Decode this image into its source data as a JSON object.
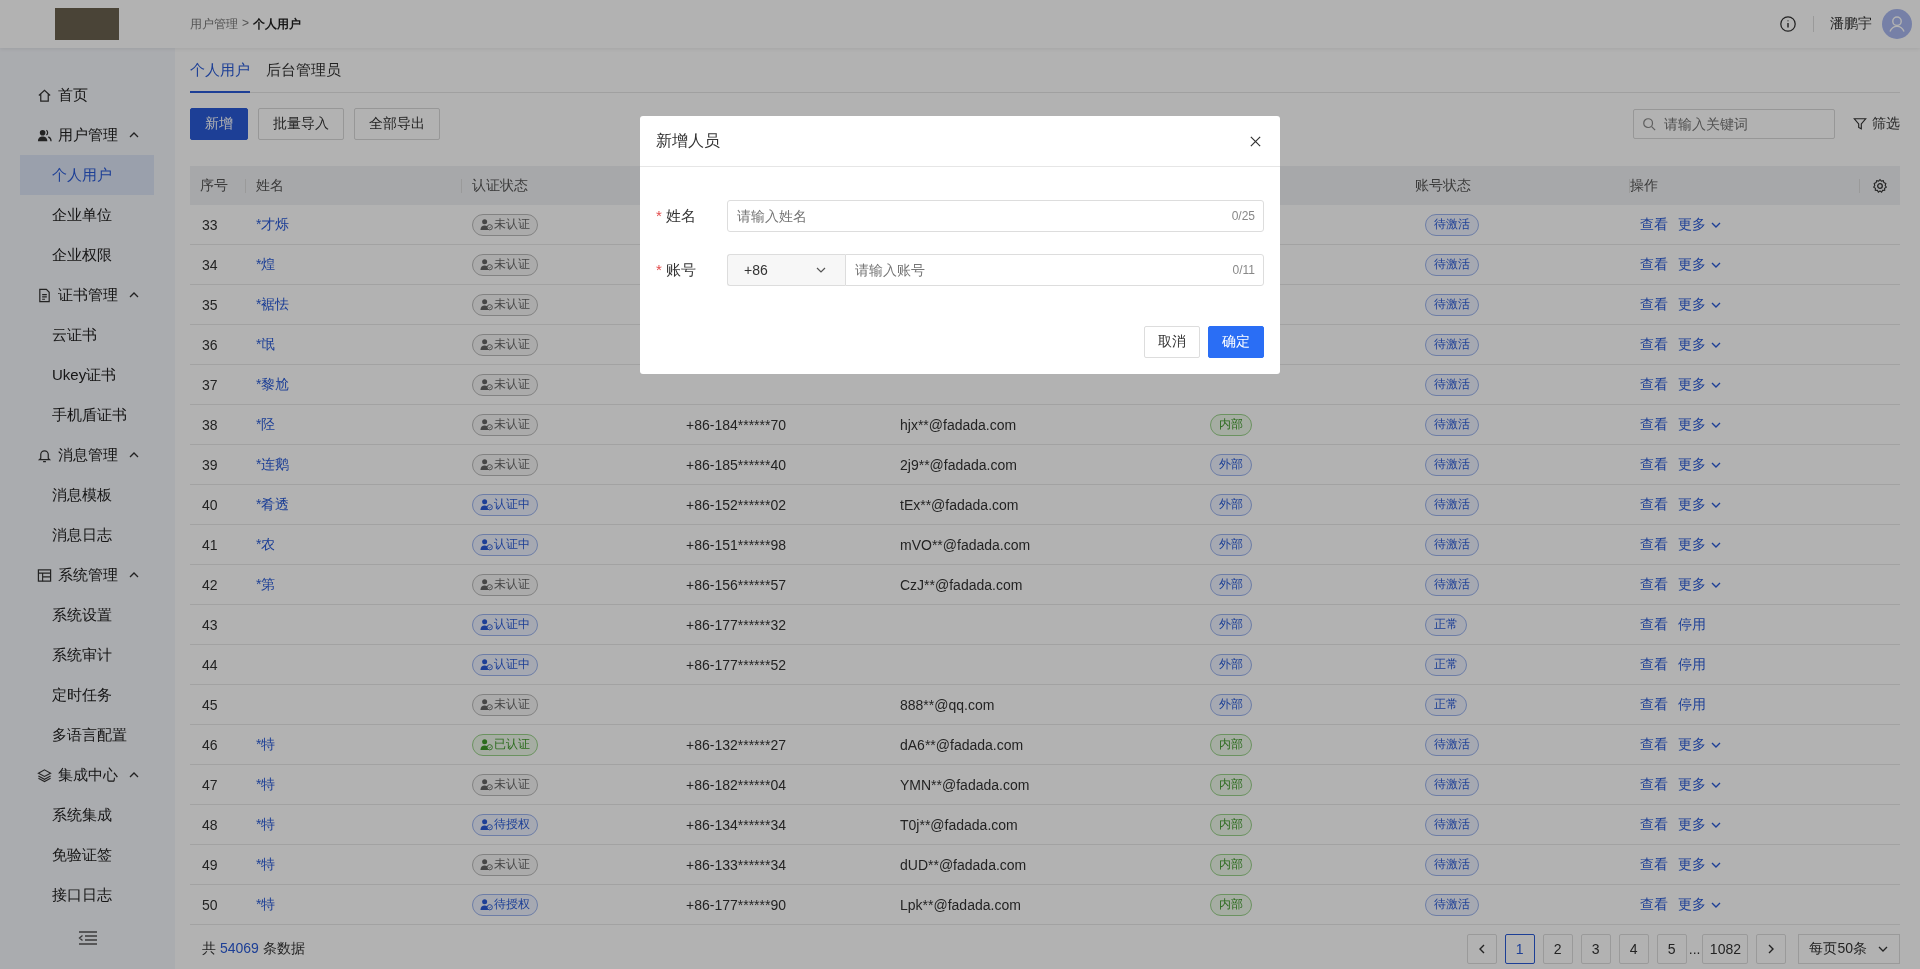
{
  "header": {
    "breadcrumb": [
      "用户管理",
      ">",
      "个人用户"
    ],
    "user_name": "潘鹏宇"
  },
  "sidebar": {
    "items": [
      {
        "label": "首页"
      },
      {
        "label": "用户管理",
        "expanded": true,
        "children": [
          {
            "label": "个人用户",
            "selected": true
          },
          {
            "label": "企业单位",
            "selected": false
          },
          {
            "label": "企业权限",
            "selected": false
          }
        ]
      },
      {
        "label": "证书管理",
        "expanded": true,
        "children": [
          {
            "label": "云证书",
            "selected": false
          },
          {
            "label": "Ukey证书",
            "selected": false
          },
          {
            "label": "手机盾证书",
            "selected": false
          }
        ]
      },
      {
        "label": "消息管理",
        "expanded": true,
        "children": [
          {
            "label": "消息模板",
            "selected": false
          },
          {
            "label": "消息日志",
            "selected": false
          }
        ]
      },
      {
        "label": "系统管理",
        "expanded": true,
        "children": [
          {
            "label": "系统设置",
            "selected": false
          },
          {
            "label": "系统审计",
            "selected": false
          },
          {
            "label": "定时任务",
            "selected": false
          },
          {
            "label": "多语言配置",
            "selected": false
          }
        ]
      },
      {
        "label": "集成中心",
        "expanded": true,
        "children": [
          {
            "label": "系统集成",
            "selected": false
          },
          {
            "label": "免验证签",
            "selected": false
          },
          {
            "label": "接口日志",
            "selected": false
          }
        ]
      }
    ]
  },
  "tabs": [
    {
      "label": "个人用户",
      "selected": true
    },
    {
      "label": "后台管理员",
      "selected": false
    }
  ],
  "toolbar": {
    "buttons": [
      {
        "label": "新增",
        "kind": "primary"
      },
      {
        "label": "批量导入",
        "kind": "default"
      },
      {
        "label": "全部导出",
        "kind": "default"
      }
    ],
    "search": {
      "placeholder": "请输入关键词"
    },
    "filter": "筛选"
  },
  "table": {
    "columns": [
      "序号",
      "姓名",
      "认证状态",
      "账号状态",
      "操作"
    ],
    "rows": [
      {
        "seq": "33",
        "name": "*才烁",
        "cert": {
          "text": "未认证",
          "kind": "none"
        },
        "account_status": "待激活",
        "actions": [
          {
            "label": "查看",
            "kind": "link"
          },
          {
            "label": "更多",
            "kind": "menu"
          }
        ]
      },
      {
        "seq": "34",
        "name": "*煌",
        "cert": {
          "text": "未认证",
          "kind": "none"
        },
        "account_status": "待激活",
        "actions": [
          {
            "label": "查看",
            "kind": "link"
          },
          {
            "label": "更多",
            "kind": "menu"
          }
        ]
      },
      {
        "seq": "35",
        "name": "*裾怯",
        "cert": {
          "text": "未认证",
          "kind": "none"
        },
        "account_status": "待激活",
        "actions": [
          {
            "label": "查看",
            "kind": "link"
          },
          {
            "label": "更多",
            "kind": "menu"
          }
        ]
      },
      {
        "seq": "36",
        "name": "*氓",
        "cert": {
          "text": "未认证",
          "kind": "none"
        },
        "account_status": "待激活",
        "actions": [
          {
            "label": "查看",
            "kind": "link"
          },
          {
            "label": "更多",
            "kind": "menu"
          }
        ]
      },
      {
        "seq": "37",
        "name": "*黎尬",
        "cert": {
          "text": "未认证",
          "kind": "none"
        },
        "account_status": "待激活",
        "actions": [
          {
            "label": "查看",
            "kind": "link"
          },
          {
            "label": "更多",
            "kind": "menu"
          }
        ]
      },
      {
        "seq": "38",
        "name": "*陉",
        "cert": {
          "text": "未认证",
          "kind": "none"
        },
        "phone": "+86-184******70",
        "email": "hjx**@fadada.com",
        "type": {
          "text": "内部",
          "kind": "internal"
        },
        "account_status": "待激活",
        "actions": [
          {
            "label": "查看",
            "kind": "link"
          },
          {
            "label": "更多",
            "kind": "menu"
          }
        ]
      },
      {
        "seq": "39",
        "name": "*连鹅",
        "cert": {
          "text": "未认证",
          "kind": "none"
        },
        "phone": "+86-185******40",
        "email": "2j9**@fadada.com",
        "type": {
          "text": "外部",
          "kind": "external"
        },
        "account_status": "待激活",
        "actions": [
          {
            "label": "查看",
            "kind": "link"
          },
          {
            "label": "更多",
            "kind": "menu"
          }
        ]
      },
      {
        "seq": "40",
        "name": "*肴透",
        "cert": {
          "text": "认证中",
          "kind": "pending"
        },
        "phone": "+86-152******02",
        "email": "tEx**@fadada.com",
        "type": {
          "text": "外部",
          "kind": "external"
        },
        "account_status": "待激活",
        "actions": [
          {
            "label": "查看",
            "kind": "link"
          },
          {
            "label": "更多",
            "kind": "menu"
          }
        ]
      },
      {
        "seq": "41",
        "name": "*农",
        "cert": {
          "text": "认证中",
          "kind": "pending"
        },
        "phone": "+86-151******98",
        "email": "mVO**@fadada.com",
        "type": {
          "text": "外部",
          "kind": "external"
        },
        "account_status": "待激活",
        "actions": [
          {
            "label": "查看",
            "kind": "link"
          },
          {
            "label": "更多",
            "kind": "menu"
          }
        ]
      },
      {
        "seq": "42",
        "name": "*第",
        "cert": {
          "text": "未认证",
          "kind": "none"
        },
        "phone": "+86-156******57",
        "email": "CzJ**@fadada.com",
        "type": {
          "text": "外部",
          "kind": "external"
        },
        "account_status": "待激活",
        "actions": [
          {
            "label": "查看",
            "kind": "link"
          },
          {
            "label": "更多",
            "kind": "menu"
          }
        ]
      },
      {
        "seq": "43",
        "cert": {
          "text": "认证中",
          "kind": "pending"
        },
        "phone": "+86-177******32",
        "type": {
          "text": "外部",
          "kind": "external"
        },
        "account_status": "正常",
        "actions": [
          {
            "label": "查看",
            "kind": "link"
          },
          {
            "label": "停用",
            "kind": "link"
          }
        ]
      },
      {
        "seq": "44",
        "cert": {
          "text": "认证中",
          "kind": "pending"
        },
        "phone": "+86-177******52",
        "type": {
          "text": "外部",
          "kind": "external"
        },
        "account_status": "正常",
        "actions": [
          {
            "label": "查看",
            "kind": "link"
          },
          {
            "label": "停用",
            "kind": "link"
          }
        ]
      },
      {
        "seq": "45",
        "cert": {
          "text": "未认证",
          "kind": "none"
        },
        "email": "888**@qq.com",
        "type": {
          "text": "外部",
          "kind": "external"
        },
        "account_status": "正常",
        "actions": [
          {
            "label": "查看",
            "kind": "link"
          },
          {
            "label": "停用",
            "kind": "link"
          }
        ]
      },
      {
        "seq": "46",
        "name": "*特",
        "cert": {
          "text": "已认证",
          "kind": "verified"
        },
        "phone": "+86-132******27",
        "email": "dA6**@fadada.com",
        "type": {
          "text": "内部",
          "kind": "internal"
        },
        "account_status": "待激活",
        "actions": [
          {
            "label": "查看",
            "kind": "link"
          },
          {
            "label": "更多",
            "kind": "menu"
          }
        ]
      },
      {
        "seq": "47",
        "name": "*特",
        "cert": {
          "text": "未认证",
          "kind": "none"
        },
        "phone": "+86-182******04",
        "email": "YMN**@fadada.com",
        "type": {
          "text": "内部",
          "kind": "internal"
        },
        "account_status": "待激活",
        "actions": [
          {
            "label": "查看",
            "kind": "link"
          },
          {
            "label": "更多",
            "kind": "menu"
          }
        ]
      },
      {
        "seq": "48",
        "name": "*特",
        "cert": {
          "text": "待授权",
          "kind": "pending"
        },
        "phone": "+86-134******34",
        "email": "T0j**@fadada.com",
        "type": {
          "text": "内部",
          "kind": "internal"
        },
        "account_status": "待激活",
        "actions": [
          {
            "label": "查看",
            "kind": "link"
          },
          {
            "label": "更多",
            "kind": "menu"
          }
        ]
      },
      {
        "seq": "49",
        "name": "*特",
        "cert": {
          "text": "未认证",
          "kind": "none"
        },
        "phone": "+86-133******34",
        "email": "dUD**@fadada.com",
        "type": {
          "text": "内部",
          "kind": "internal"
        },
        "account_status": "待激活",
        "actions": [
          {
            "label": "查看",
            "kind": "link"
          },
          {
            "label": "更多",
            "kind": "menu"
          }
        ]
      },
      {
        "seq": "50",
        "name": "*特",
        "cert": {
          "text": "待授权",
          "kind": "pending"
        },
        "phone": "+86-177******90",
        "email": "Lpk**@fadada.com",
        "type": {
          "text": "内部",
          "kind": "internal"
        },
        "account_status": "待激活",
        "actions": [
          {
            "label": "查看",
            "kind": "link"
          },
          {
            "label": "更多",
            "kind": "menu"
          }
        ]
      }
    ]
  },
  "footer": {
    "total": [
      "共",
      "54069",
      "条数据"
    ],
    "pages": [
      {
        "label": "1",
        "selected": true
      },
      {
        "label": "2",
        "selected": false
      },
      {
        "label": "3",
        "selected": false
      },
      {
        "label": "4",
        "selected": false
      },
      {
        "label": "5",
        "selected": false
      }
    ],
    "ellipsis": "...",
    "last_page": "1082",
    "page_size": "每页50条"
  },
  "dialog": {
    "title": "新增人员",
    "fields": [
      {
        "label": "姓名",
        "required_mark": "*",
        "placeholder": "请输入姓名",
        "counter": "0/25"
      },
      {
        "label": "账号",
        "required_mark": "*",
        "prefix": "+86",
        "placeholder": "请输入账号",
        "counter": "0/11"
      }
    ],
    "buttons": [
      {
        "label": "取消",
        "kind": "default"
      },
      {
        "label": "确定",
        "kind": "primary"
      }
    ]
  }
}
